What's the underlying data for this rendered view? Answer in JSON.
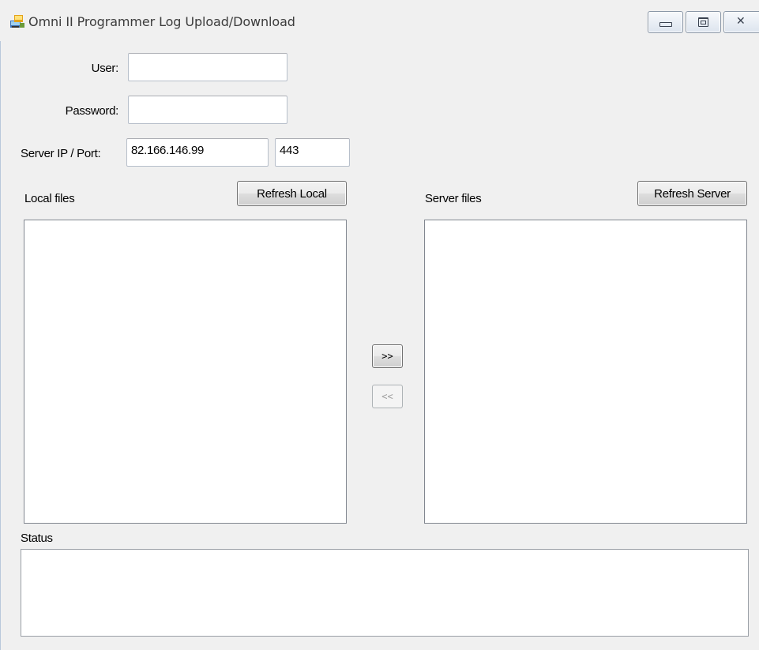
{
  "window": {
    "title": "Omni II Programmer Log Upload/Download",
    "icon": "app-icon"
  },
  "form": {
    "user_label": "User:",
    "user_value": "",
    "password_label": "Password:",
    "password_value": "",
    "server_label": "Server IP / Port:",
    "server_ip": "82.166.146.99",
    "server_port": "443"
  },
  "local": {
    "label": "Local files",
    "refresh_label": "Refresh Local",
    "items": []
  },
  "server": {
    "label": "Server files",
    "refresh_label": "Refresh Server",
    "items": []
  },
  "transfer": {
    "upload_label": ">>",
    "download_label": "<<"
  },
  "status": {
    "label": "Status",
    "text": ""
  },
  "colors": {
    "window_bg": "#f0f0f0",
    "disabled_text": "#a0a0a0"
  }
}
